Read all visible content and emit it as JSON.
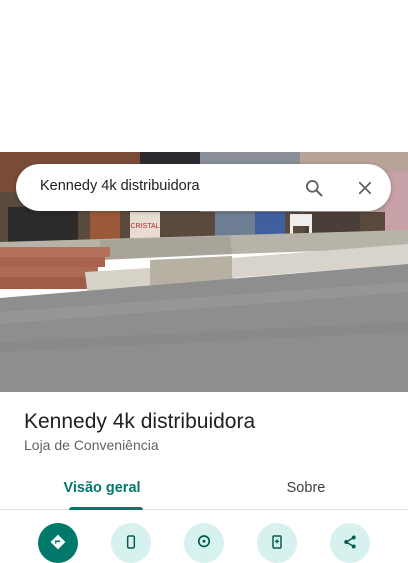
{
  "search": {
    "query": "Kennedy 4k distribuidora"
  },
  "place": {
    "title": "Kennedy 4k distribuidora",
    "category": "Loja de Conveniência"
  },
  "photo": {
    "sign_text": "CRISTAL"
  },
  "tabs": [
    {
      "label": "Visão geral",
      "selected": true
    },
    {
      "label": "Sobre",
      "selected": false
    }
  ],
  "actions": [
    {
      "icon": "directions-icon"
    },
    {
      "icon": "phone-icon"
    },
    {
      "icon": "place-add-icon"
    },
    {
      "icon": "save-icon"
    },
    {
      "icon": "share-icon"
    }
  ],
  "colors": {
    "accent": "#00796b",
    "action_bg": "#d7f1ee"
  }
}
